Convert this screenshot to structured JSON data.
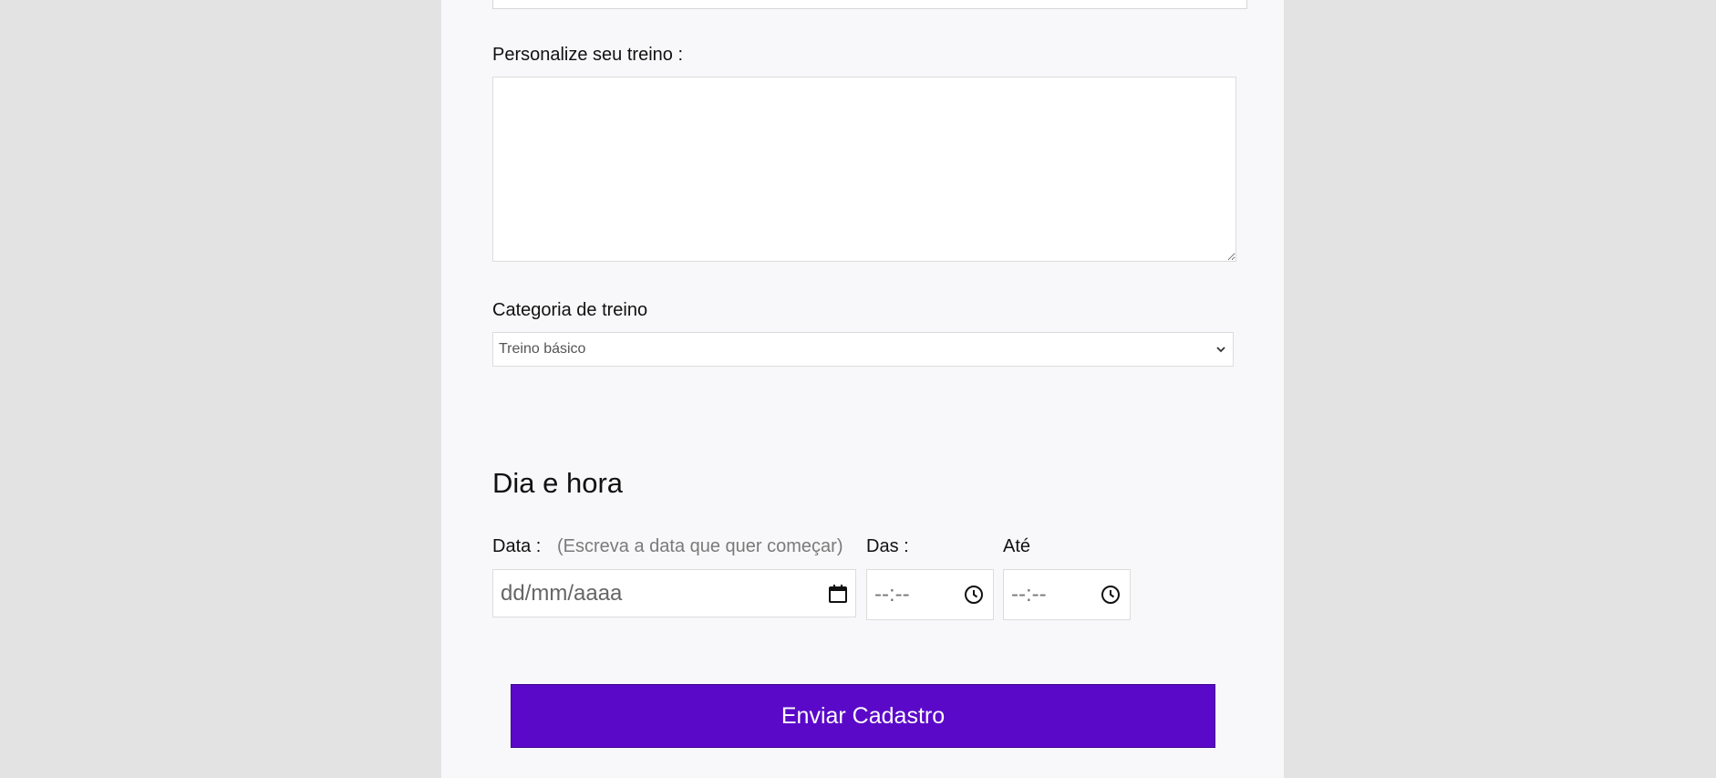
{
  "form": {
    "customize": {
      "label": "Personalize seu treino :",
      "value": ""
    },
    "category": {
      "label": "Categoria de treino",
      "selected": "Treino básico"
    },
    "schedule": {
      "title": "Dia e hora",
      "date_label": "Data :",
      "date_hint": "(Escreva a data que quer começar)",
      "date_placeholder": "dd/mm/aaaa",
      "from_label": "Das :",
      "from_placeholder": "--:--",
      "to_label": "Até",
      "to_placeholder": "--:--"
    },
    "submit_label": "Enviar Cadastro"
  },
  "colors": {
    "accent": "#5b09c9",
    "page_bg": "#e3e3e3",
    "panel_bg": "#f8f8fa"
  },
  "icons": {
    "select_arrow": "chevron-down-icon",
    "date": "calendar-icon",
    "time": "clock-icon"
  }
}
